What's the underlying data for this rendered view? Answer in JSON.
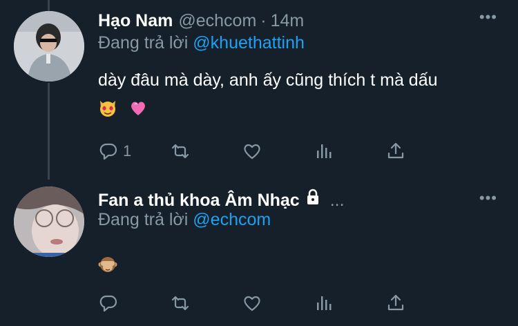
{
  "tweets": [
    {
      "display_name": "Hạo Nam",
      "handle": "@echcom",
      "separator": "·",
      "time": "14m",
      "reply_prefix": "Đang trả lời",
      "reply_to": "@khuethattinh",
      "text": "dày đâu mà dày, anh ấy cũng thích t mà dấu",
      "emojis": [
        "heart-eyes-cat-emoji",
        "pink-heart-emoji"
      ],
      "actions": {
        "reply_count": "1",
        "retweet_count": "",
        "like_count": ""
      }
    },
    {
      "display_name": "Fan a thủ khoa Âm Nhạc",
      "truncation": "...",
      "reply_prefix": "Đang trả lời",
      "reply_to": "@echcom",
      "emojis": [
        "see-no-evil-monkey-emoji"
      ],
      "protected": true,
      "actions": {
        "reply_count": "",
        "retweet_count": "",
        "like_count": ""
      }
    }
  ],
  "more_glyph": "•••",
  "colors": {
    "background": "#15202b",
    "secondary": "#8899a6",
    "link": "#1da1f2",
    "thread_line": "#38444d"
  }
}
